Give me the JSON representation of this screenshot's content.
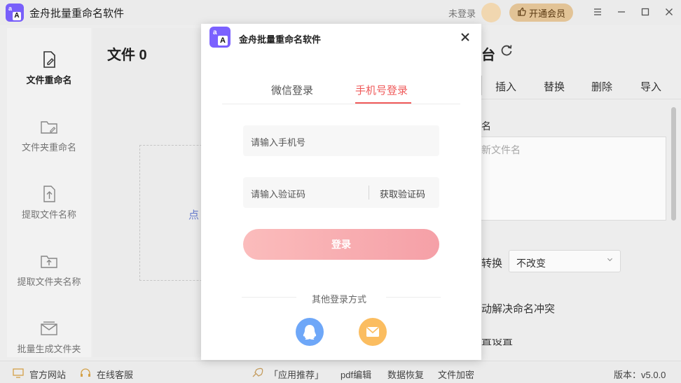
{
  "titlebar": {
    "app_title": "金舟批量重命名软件",
    "logo_text_top": "a",
    "logo_text_bottom": "A",
    "login_status": "未登录",
    "vip_label": "开通会员",
    "thumb_icon": "thumb-up-icon",
    "window_controls": [
      "settings-icon",
      "minimize-icon",
      "maximize-icon",
      "close-icon"
    ]
  },
  "sidebar": {
    "items": [
      {
        "label": "文件重命名",
        "icon": "file-edit-icon",
        "active": true
      },
      {
        "label": "文件夹重命名",
        "icon": "folder-edit-icon",
        "active": false
      },
      {
        "label": "提取文件名称",
        "icon": "file-extract-icon",
        "active": false
      },
      {
        "label": "提取文件夹名称",
        "icon": "folder-extract-icon",
        "active": false
      },
      {
        "label": "批量生成文件夹",
        "icon": "folders-generate-icon",
        "active": false
      }
    ]
  },
  "main": {
    "files_title": "文件 0",
    "drop_hint": "点"
  },
  "right_panel": {
    "title_fragment": "台",
    "refresh_icon": "refresh-icon",
    "tabs": [
      "插入",
      "替换",
      "删除",
      "导入"
    ],
    "name_label": "名",
    "new_name_placeholder": "新文件名",
    "convert_label": "转换",
    "convert_value": "不改变",
    "conflict_label": "动解决命名冲突",
    "settings_label": "置设置"
  },
  "statusbar": {
    "website": "官方网站",
    "online_service": "在线客服",
    "app_recommend": "「应用推荐」",
    "links": [
      "pdf编辑",
      "数据恢复",
      "文件加密"
    ],
    "version": "版本：v5.0.0"
  },
  "modal": {
    "title": "金舟批量重命名软件",
    "tabs": [
      {
        "label": "微信登录",
        "active": false
      },
      {
        "label": "手机号登录",
        "active": true
      }
    ],
    "phone_placeholder": "请输入手机号",
    "code_placeholder": "请输入验证码",
    "get_code_label": "获取验证码",
    "login_label": "登录",
    "other_methods_label": "其他登录方式",
    "other_methods": [
      {
        "icon": "qq-icon",
        "color": "#6ea7f8"
      },
      {
        "icon": "mail-icon",
        "color": "#fbbd60"
      }
    ],
    "accent_color": "#ef5a5a"
  }
}
